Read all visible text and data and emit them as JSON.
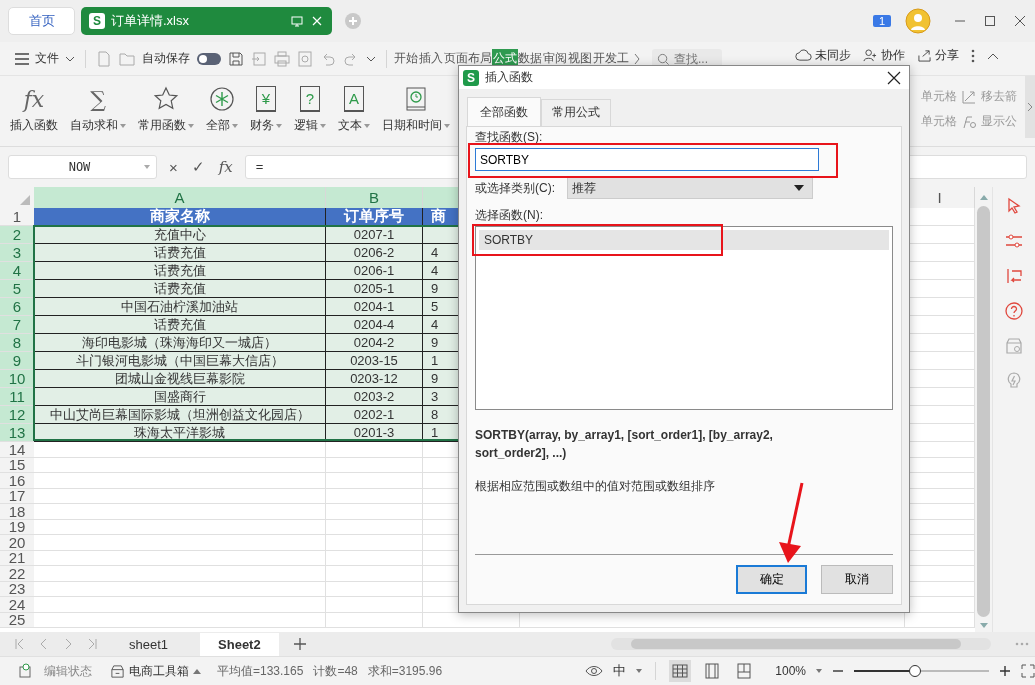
{
  "tabs": [
    {
      "label": "首页",
      "selected": false,
      "kind": "home"
    },
    {
      "label": "订单详情.xlsx",
      "selected": true,
      "kind": "file",
      "logo_letter": "S"
    }
  ],
  "notification_count": "1",
  "menu": {
    "file_label": "文件",
    "autosave_label": "自动保存",
    "autosave_on": false,
    "ribbon_tabs": [
      {
        "label": "开始",
        "selected": false
      },
      {
        "label": "插入",
        "selected": false
      },
      {
        "label": "页面布局",
        "selected": false
      },
      {
        "label": "公式",
        "selected": true
      },
      {
        "label": "数据",
        "selected": false
      },
      {
        "label": "审阅",
        "selected": false
      },
      {
        "label": "视图",
        "selected": false
      },
      {
        "label": "开发工",
        "selected": false
      }
    ],
    "search_placeholder": "查找...",
    "sync_label": "未同步",
    "collab_label": "协作",
    "share_label": "分享"
  },
  "ribbon": {
    "groups": [
      {
        "label": "插入函数",
        "kind": "plain",
        "glyph": "fx",
        "dropdown": false
      },
      {
        "label": "自动求和",
        "kind": "plain",
        "glyph": "∑",
        "dropdown": true
      },
      {
        "label": "常用函数",
        "kind": "star",
        "dropdown": true
      },
      {
        "label": "全部",
        "kind": "asterisk",
        "dropdown": true
      },
      {
        "label": "财务",
        "kind": "book",
        "glyph": "¥",
        "dropdown": true
      },
      {
        "label": "逻辑",
        "kind": "book",
        "glyph": "?",
        "dropdown": true
      },
      {
        "label": "文本",
        "kind": "book",
        "glyph": "A",
        "dropdown": true
      },
      {
        "label": "日期和时间",
        "kind": "clock",
        "dropdown": true
      }
    ],
    "right_rows": [
      [
        "单元格",
        "移去箭"
      ],
      [
        "单元格",
        "显示公"
      ]
    ]
  },
  "formula_bar": {
    "name_box": "NOW",
    "buttons": [
      "×",
      "✓",
      "fx"
    ],
    "formula": "="
  },
  "sheet": {
    "columns": [
      {
        "label": "A",
        "selected": true
      },
      {
        "label": "B",
        "selected": true
      },
      {
        "selected": true
      },
      {
        "label": "I",
        "selected": false
      }
    ],
    "rows": [
      {
        "number": "1",
        "kind": "header",
        "selected": false,
        "cells": [
          "商家名称",
          "订单序号",
          "商"
        ]
      },
      {
        "number": "2",
        "kind": "data",
        "selected": true,
        "cells": [
          "充值中心",
          "0207-1"
        ]
      },
      {
        "number": "3",
        "kind": "data",
        "selected": true,
        "cells": [
          "话费充值",
          "0206-2",
          "4"
        ]
      },
      {
        "number": "4",
        "kind": "data",
        "selected": true,
        "cells": [
          "话费充值",
          "0206-1",
          "4"
        ]
      },
      {
        "number": "5",
        "kind": "data",
        "selected": true,
        "cells": [
          "话费充值",
          "0205-1",
          "9"
        ]
      },
      {
        "number": "6",
        "kind": "data",
        "selected": true,
        "cells": [
          "中国石油柠溪加油站",
          "0204-1",
          "5"
        ]
      },
      {
        "number": "7",
        "kind": "data",
        "selected": true,
        "cells": [
          "话费充值",
          "0204-4",
          "4"
        ]
      },
      {
        "number": "8",
        "kind": "data",
        "selected": true,
        "cells": [
          "海印电影城（珠海海印又一城店）",
          "0204-2",
          "9"
        ]
      },
      {
        "number": "9",
        "kind": "data",
        "selected": true,
        "cells": [
          "斗门银河电影城（中国巨幕大信店）",
          "0203-15",
          "1"
        ]
      },
      {
        "number": "10",
        "kind": "data",
        "selected": true,
        "cells": [
          "团城山金视线巨幕影院",
          "0203-12",
          "9"
        ]
      },
      {
        "number": "11",
        "kind": "data",
        "selected": true,
        "cells": [
          "国盛商行",
          "0203-2",
          "3"
        ]
      },
      {
        "number": "12",
        "kind": "data",
        "selected": true,
        "cells": [
          "中山艾尚巨幕国际影城（坦洲创益文化园店）",
          "0202-1",
          "8"
        ]
      },
      {
        "number": "13",
        "kind": "data",
        "selected": true,
        "cells": [
          "珠海太平洋影城",
          "0201-3",
          "1"
        ]
      },
      {
        "number": "14",
        "kind": "empty",
        "selected": false
      },
      {
        "number": "15",
        "kind": "empty",
        "selected": false
      },
      {
        "number": "16",
        "kind": "empty",
        "selected": false
      },
      {
        "number": "17",
        "kind": "empty",
        "selected": false
      },
      {
        "number": "18",
        "kind": "empty",
        "selected": false
      },
      {
        "number": "19",
        "kind": "empty",
        "selected": false
      },
      {
        "number": "20",
        "kind": "empty",
        "selected": false
      },
      {
        "number": "21",
        "kind": "empty",
        "selected": false
      },
      {
        "number": "22",
        "kind": "empty",
        "selected": false
      },
      {
        "number": "23",
        "kind": "empty",
        "selected": false
      },
      {
        "number": "24",
        "kind": "empty",
        "selected": false
      },
      {
        "number": "25",
        "kind": "empty",
        "selected": false
      }
    ]
  },
  "sheet_tabs": [
    {
      "label": "sheet1",
      "selected": false
    },
    {
      "label": "Sheet2",
      "selected": true
    }
  ],
  "status_bar": {
    "mode": "编辑状态",
    "toolbox": "电商工具箱",
    "stats": [
      "平均值=133.165",
      "计数=48",
      "求和=3195.96"
    ],
    "ime": "中",
    "view_modes": [
      {
        "kind": "normal",
        "selected": true
      },
      {
        "kind": "page",
        "selected": false
      },
      {
        "kind": "break",
        "selected": false
      }
    ],
    "zoom": "100%",
    "zoom_slider": {
      "level": 0.45
    }
  },
  "dialog": {
    "logo_letter": "S",
    "title": "插入函数",
    "tabs": [
      {
        "label": "全部函数",
        "selected": true
      },
      {
        "label": "常用公式",
        "selected": false
      }
    ],
    "search_label": "查找函数(S):",
    "search_value": "SORTBY",
    "category_label": "或选择类别(C):",
    "category_value": "推荐",
    "list_label": "选择函数(N):",
    "functions": [
      {
        "name": "SORTBY",
        "selected": true
      }
    ],
    "signature": "SORTBY(array, by_array1, [sort_order1], [by_array2, sort_order2], ...)",
    "description": "根据相应范围或数组中的值对范围或数组排序",
    "buttons": [
      {
        "label": "确定",
        "kind": "primary"
      },
      {
        "label": "取消",
        "kind": "secondary"
      }
    ]
  }
}
